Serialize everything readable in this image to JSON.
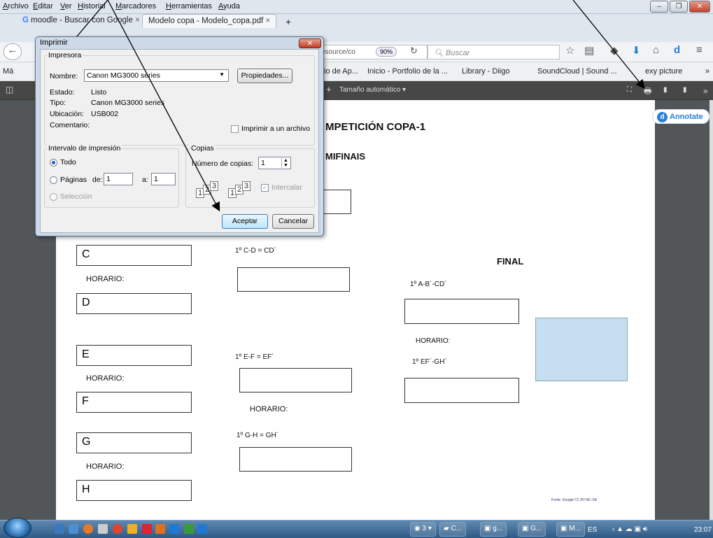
{
  "menubar": {
    "items": [
      "Archivo",
      "Editar",
      "Ver",
      "Historial",
      "Marcadores",
      "Herramientas",
      "Ayuda"
    ]
  },
  "tabs": [
    {
      "label": "moodle - Buscar con Google",
      "close": "×"
    },
    {
      "label": "Modelo copa - Modelo_copa.pdf",
      "close": "×"
    },
    {
      "label": "+"
    }
  ],
  "navbar": {
    "url": "esource/co",
    "zoom": "90%",
    "search_placeholder": "Buscar"
  },
  "bookmarks": {
    "left": "Má",
    "items": [
      "io de Ap...",
      "Inicio - Portfolio de la ...",
      "Library - Diigo",
      "SoundCloud | Sound ...",
      "exy picture"
    ],
    "more": "»"
  },
  "pdf_toolbar": {
    "plus": "+",
    "zoom_select": "Tamaño automático",
    "more": "»"
  },
  "annotate": {
    "label": "Annotate",
    "icon_letter": "d"
  },
  "pdf": {
    "title": "MPETICIÓN  COPA-1",
    "semis": "MIFINAIS",
    "final": "FINAL",
    "teams": [
      "C",
      "D",
      "E",
      "F",
      "G",
      "H"
    ],
    "horario": "HORARIO:",
    "match_cd": "1º C-D = CD´",
    "match_ef": "1º E-F  =  EF´",
    "match_gh": "1º G-H = GH´",
    "match_abcd": "1º A-B´-CD´",
    "match_efgh": "1º EF´-GH´",
    "footer": "Fonte: Google  CC BY-NC-SA"
  },
  "dialog": {
    "title": "Imprimir",
    "close": "✕",
    "printer_group": "Impresora",
    "name_label": "Nombre:",
    "name_value": "Canon MG3000 series",
    "props_button": "Propiedades...",
    "status_label": "Estado:",
    "status_value": "Listo",
    "type_label": "Tipo:",
    "type_value": "Canon MG3000 series",
    "location_label": "Ubicación:",
    "location_value": "USB002",
    "comment_label": "Comentario:",
    "print_to_file": "Imprimir a un archivo",
    "range_group": "Intervalo de impresión",
    "range_all": "Todo",
    "range_pages": "Páginas",
    "from_label": "de:",
    "from_value": "1",
    "to_label": "a:",
    "to_value": "1",
    "range_selection": "Selección",
    "copies_group": "Copias",
    "copies_label": "Número de copias:",
    "copies_value": "1",
    "collate": "Intercalar",
    "collate_icons": [
      "1",
      "2",
      "3"
    ],
    "ok_button": "Aceptar",
    "cancel_button": "Cancelar"
  },
  "taskbar": {
    "buttons": [
      "3",
      "C...",
      "g...",
      "G...",
      "M..."
    ],
    "lang": "ES",
    "clock": "23:07"
  }
}
